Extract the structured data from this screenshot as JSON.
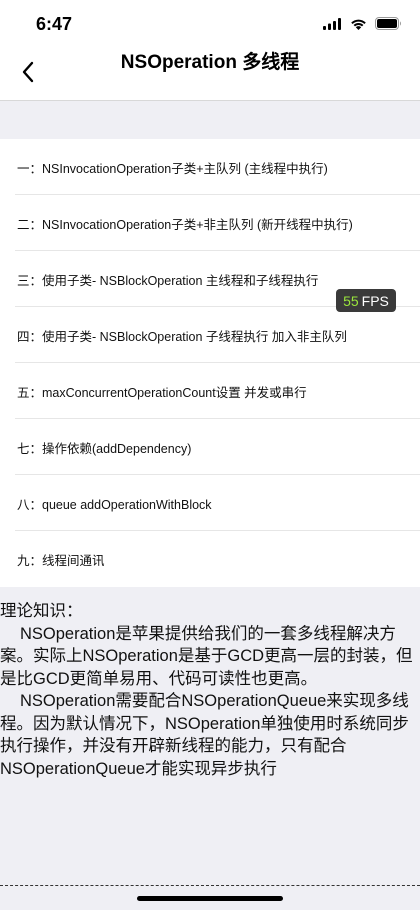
{
  "status_bar": {
    "time": "6:47"
  },
  "nav": {
    "title": "NSOperation 多线程"
  },
  "menu": {
    "items": [
      {
        "label": "一：NSInvocationOperation子类+主队列 (主线程中执行)"
      },
      {
        "label": "二：NSInvocationOperation子类+非主队列 (新开线程中执行)"
      },
      {
        "label": "三：使用子类- NSBlockOperation 主线程和子线程执行"
      },
      {
        "label": "四：使用子类- NSBlockOperation 子线程执行 加入非主队列"
      },
      {
        "label": "五：maxConcurrentOperationCount设置 并发或串行"
      },
      {
        "label": "七：操作依赖(addDependency)"
      },
      {
        "label": "八：queue addOperationWithBlock"
      },
      {
        "label": "九：线程间通讯"
      }
    ]
  },
  "fps": {
    "value": "55",
    "unit": "FPS"
  },
  "theory": {
    "heading": "理论知识：",
    "paragraphs": [
      "NSOperation是苹果提供给我们的一套多线程解决方案。实际上NSOperation是基于GCD更高一层的封装，但是比GCD更简单易用、代码可读性也更高。",
      "NSOperation需要配合NSOperationQueue来实现多线程。因为默认情况下，NSOperation单独使用时系统同步执行操作，并没有开辟新线程的能力，只有配合NSOperationQueue才能实现异步执行"
    ]
  }
}
